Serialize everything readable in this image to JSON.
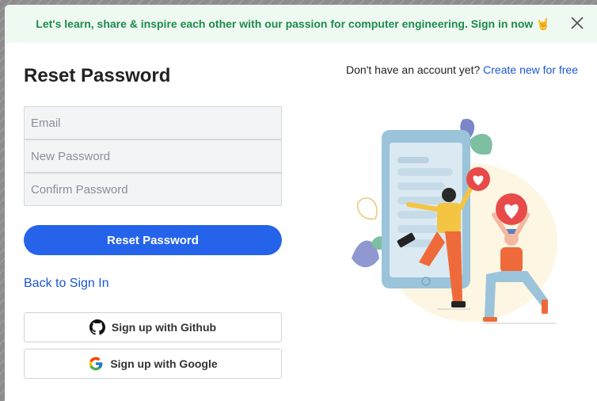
{
  "banner": {
    "text": "Let's learn, share & inspire each other with our passion for computer engineering. Sign in now",
    "emoji": "🤘"
  },
  "form": {
    "title": "Reset Password",
    "email_placeholder": "Email",
    "new_password_placeholder": "New Password",
    "confirm_password_placeholder": "Confirm Password",
    "submit_label": "Reset Password",
    "back_link": "Back to Sign In",
    "github_label": "Sign up with Github",
    "google_label": "Sign up with Google"
  },
  "signup": {
    "prompt": "Don't have an account yet?",
    "link": "Create new for free"
  },
  "colors": {
    "accent": "#2563eb",
    "banner_bg": "#eefaf1",
    "banner_text": "#1e8a4c",
    "link": "#1a56d6"
  },
  "icons": [
    "close-icon",
    "github-icon",
    "google-icon",
    "heart-icon"
  ]
}
